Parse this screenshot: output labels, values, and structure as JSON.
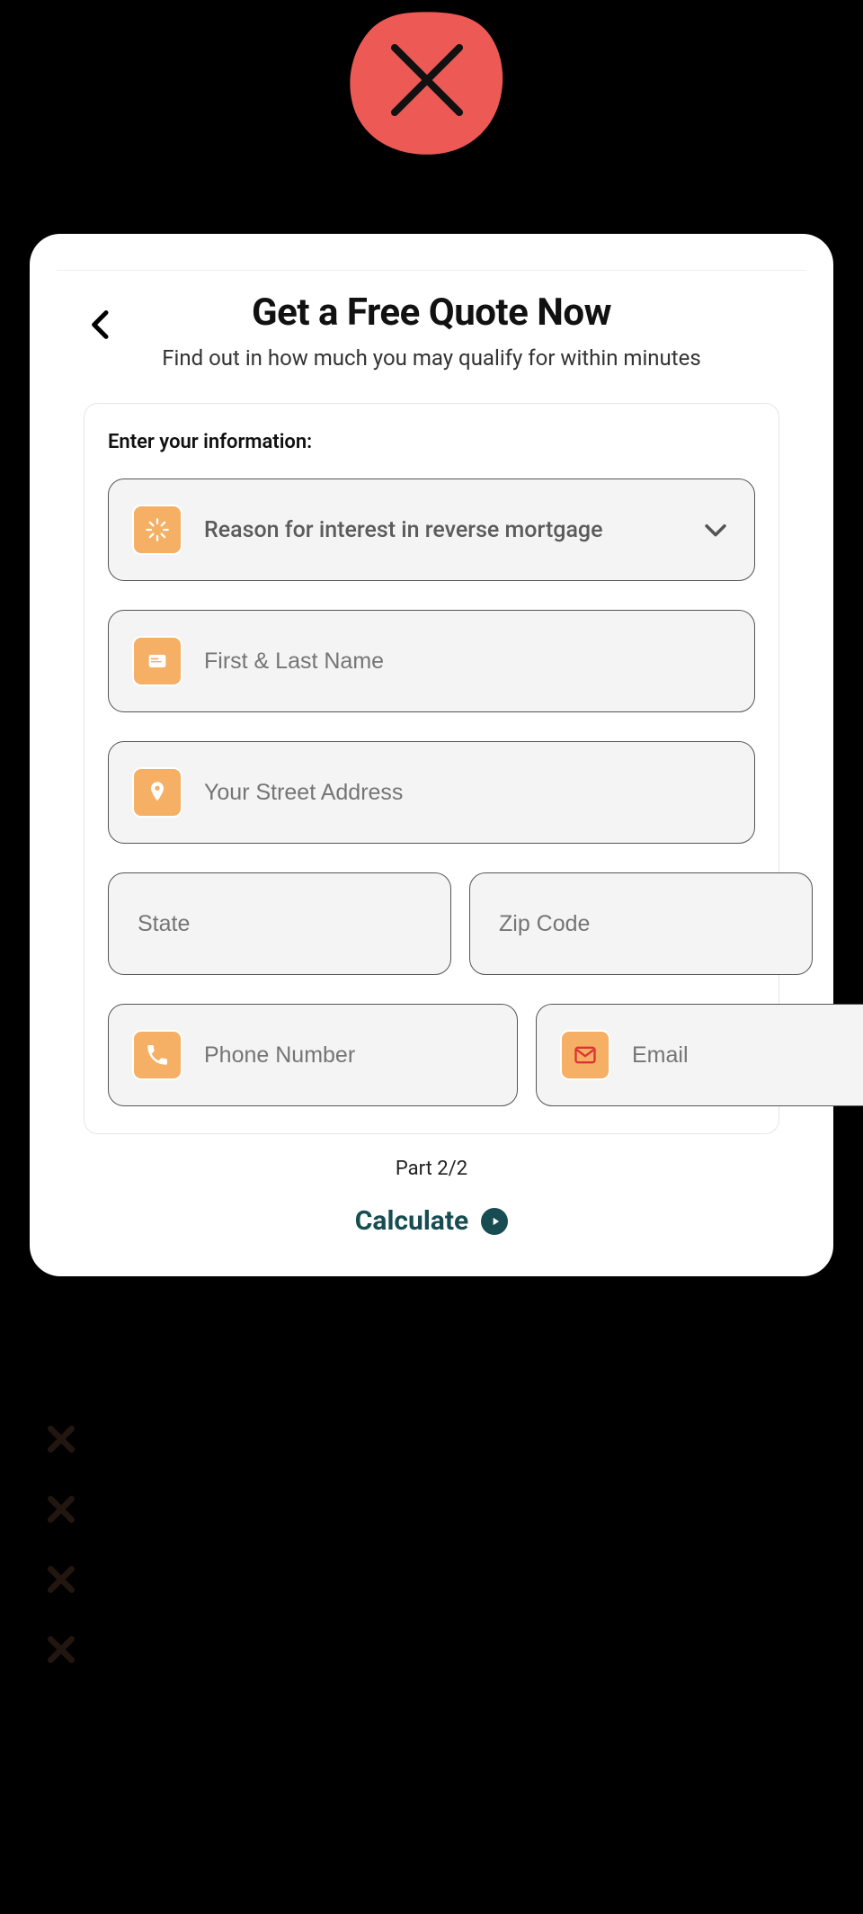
{
  "header": {
    "title": "Get a Free Quote Now",
    "subtitle": "Find out in how much you may qualify for within minutes"
  },
  "form": {
    "section_label": "Enter your information:",
    "reason_placeholder": "Reason for interest in reverse mortgage",
    "name_placeholder": "First & Last Name",
    "address_placeholder": "Your Street Address",
    "state_placeholder": "State",
    "zip_placeholder": "Zip Code",
    "phone_placeholder": "Phone Number",
    "email_placeholder": "Email"
  },
  "footer": {
    "part_label": "Part 2/2",
    "calculate_label": "Calculate"
  }
}
